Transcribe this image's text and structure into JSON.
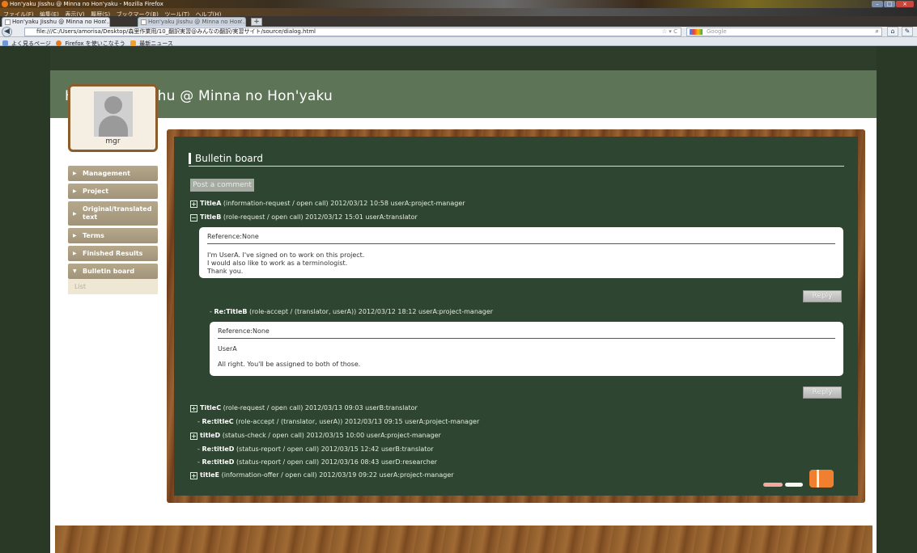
{
  "browser": {
    "window_title": "Hon'yaku Jisshu @ Minna no Hon'yaku - Mozilla Firefox",
    "menu": [
      "ファイル(F)",
      "編集(E)",
      "表示(V)",
      "履歴(S)",
      "ブックマーク(B)",
      "ツール(T)",
      "ヘルプ(H)"
    ],
    "tabs": [
      {
        "label": "Hon'yaku Jisshu @ Minna no Hon'..."
      },
      {
        "label": "Hon'yaku Jisshu @ Minna no Hon'..."
      }
    ],
    "url": "file:///C:/Users/amorisa/Desktop/森里作業用/10_翻訳実習@みんなの翻訳/実習サイト/source/dialog.html",
    "search_placeholder": "Google",
    "bookmarks": [
      "よく見るページ",
      "Firefox を使いこなそう",
      "最新ニュース"
    ]
  },
  "site": {
    "title": "Hon'yaku Jisshu @ Minna no Hon'yaku"
  },
  "profile": {
    "username": "mgr"
  },
  "sidebar": {
    "items": [
      {
        "label": "Management",
        "arrow": "▶"
      },
      {
        "label": "Project",
        "arrow": "▶"
      },
      {
        "label": "Original/translated text",
        "arrow": "▶"
      },
      {
        "label": "Terms",
        "arrow": "▶"
      },
      {
        "label": "Finished Results",
        "arrow": "▶"
      },
      {
        "label": "Bulletin board",
        "arrow": "▼"
      }
    ],
    "sub_items": [
      {
        "label": "List"
      }
    ]
  },
  "board": {
    "heading": "Bulletin board",
    "post_button": "Post a comment",
    "threads": [
      {
        "toggle": "+",
        "title": "TitleA",
        "meta": " (information-request / open call) 2012/03/12 10:58 userA:project-manager"
      },
      {
        "toggle": "−",
        "title": "TitleB",
        "meta": " (role-request / open call) 2012/03/12 15:01 userA:translator"
      }
    ],
    "message1": {
      "reference": "Reference:None",
      "body": "I'm UserA. I've signed on to work on this project.\nI would also like to work as a terminologist.\nThank you."
    },
    "reply_label": "Reply",
    "reply1": {
      "prefix": "- ",
      "title": "Re:TitleB",
      "meta": " (role-accept / (translator, userA)) 2012/03/12 18:12 userA:project-manager"
    },
    "message2": {
      "reference": "Reference:None",
      "line1": "UserA",
      "line2": "All right. You'll be assigned to both of those."
    },
    "threads2": [
      {
        "toggle": "+",
        "prefix": "",
        "title": "TitleC",
        "meta": " (role-request / open call) 2012/03/13 09:03 userB:translator",
        "reply": false
      },
      {
        "toggle": "",
        "prefix": "- ",
        "title": "Re:titleC",
        "meta": " (role-accept / (translator, userA)) 2012/03/13 09:15 userA:project-manager",
        "reply": true
      },
      {
        "toggle": "+",
        "prefix": "",
        "title": "titleD",
        "meta": " (status-check / open call) 2012/03/15 10:00 userA:project-manager",
        "reply": false
      },
      {
        "toggle": "",
        "prefix": "- ",
        "title": "Re:titleD",
        "meta": " (status-report / open call) 2012/03/15 12:42 userB:translator",
        "reply": true
      },
      {
        "toggle": "",
        "prefix": "- ",
        "title": "Re:titleD",
        "meta": " (status-report / open call) 2012/03/16 08:43 userD:researcher",
        "reply": true
      },
      {
        "toggle": "+",
        "prefix": "",
        "title": "titleE",
        "meta": " (information-offer / open call) 2012/03/19 09:22 userA:project-manager",
        "reply": false
      }
    ]
  },
  "colors": {
    "header_green": "#5d7457",
    "board_green": "#2e4631",
    "sidebar_tan": "#b5a88a",
    "chalk_pink": "#f4a8a0",
    "eraser_orange": "#f08030"
  }
}
